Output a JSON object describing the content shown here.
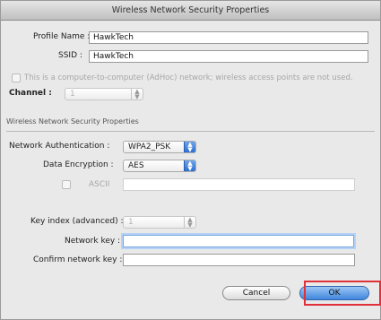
{
  "window": {
    "title": "Wireless Network Security Properties"
  },
  "top": {
    "profile_name_label": "Profile Name :",
    "profile_name_value": "HawkTech",
    "ssid_label": "SSID :",
    "ssid_value": "HawkTech",
    "adhoc_label": "This is a computer-to-computer (AdHoc) network; wireless access points are not used.",
    "channel_label": "Channel :",
    "channel_value": "1"
  },
  "security": {
    "group_title": "Wireless Network Security Properties",
    "auth_label": "Network Authentication :",
    "auth_value": "WPA2_PSK",
    "encryption_label": "Data Encryption :",
    "encryption_value": "AES",
    "ascii_label": "ASCII",
    "key_index_label": "Key index (advanced) :",
    "key_index_value": "1",
    "network_key_label": "Network key :",
    "confirm_key_label": "Confirm network key :"
  },
  "buttons": {
    "cancel": "Cancel",
    "ok": "OK"
  },
  "colors": {
    "highlight": "#e0303a",
    "accent": "#3f86dd"
  }
}
